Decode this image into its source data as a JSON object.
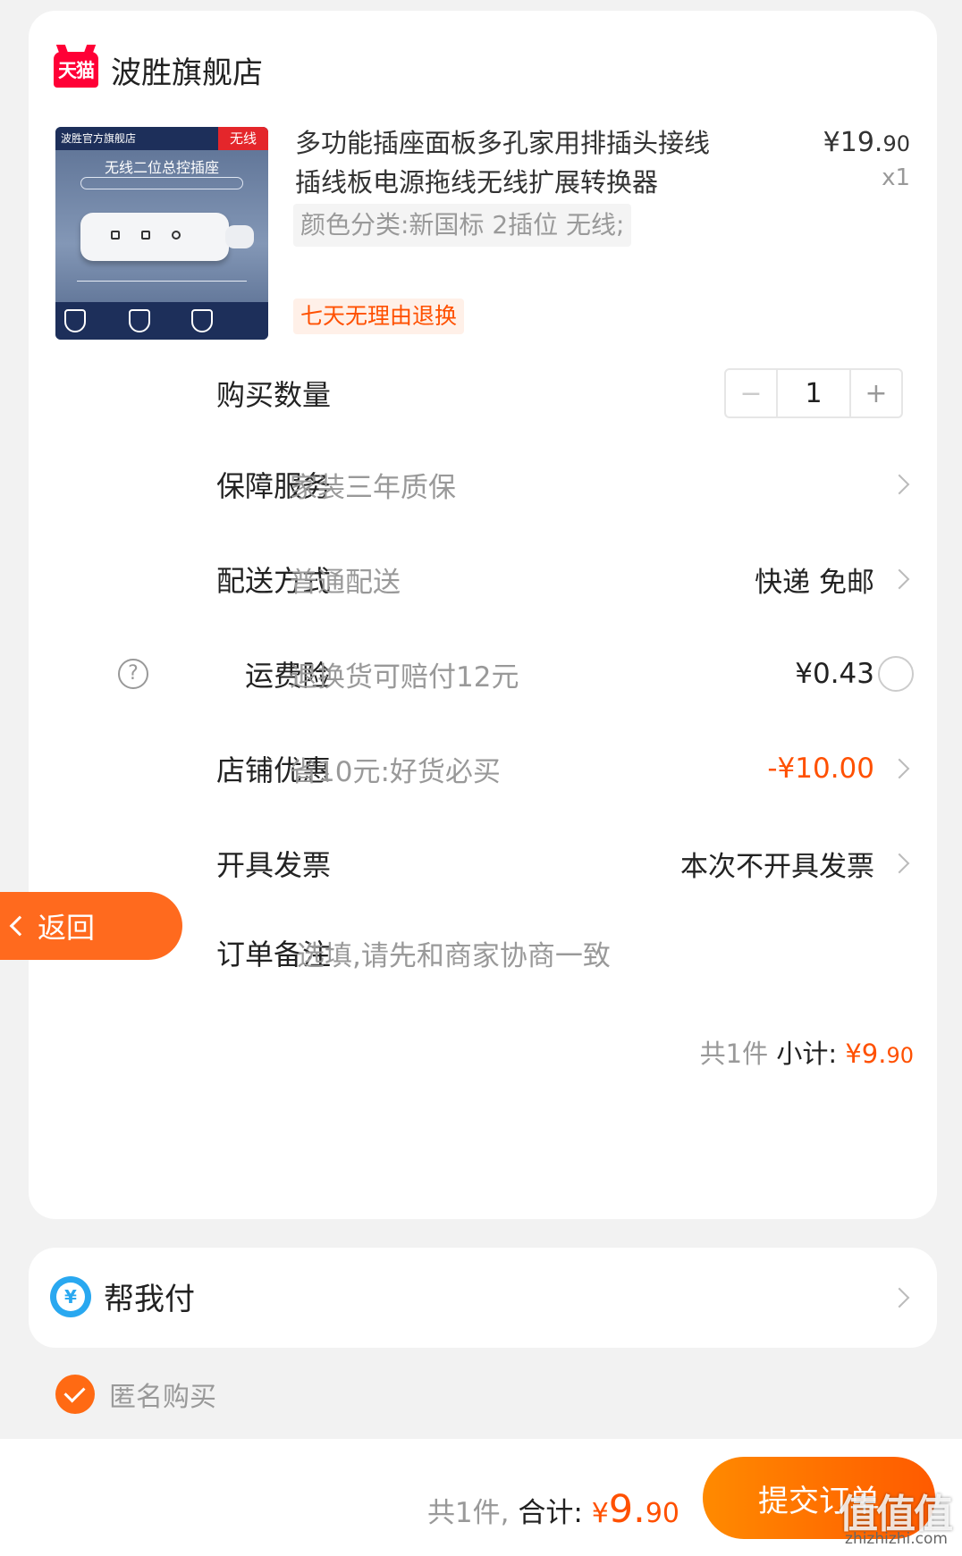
{
  "store": {
    "logo_text": "天猫",
    "name": "波胜旗舰店"
  },
  "product": {
    "thumbnail": {
      "brand": "波胜官方旗舰店",
      "tag": "无线",
      "title": "无线二位总控插座"
    },
    "title": "多功能插座面板多孔家用排插头接线插线板电源拖线无线扩展转换器",
    "price_prefix": "¥19.",
    "price_cents": "90",
    "quantity": "x1",
    "sku": "颜色分类:新国标 2插位 无线;",
    "return_tag": "七天无理由退换"
  },
  "rows": {
    "quantity": {
      "label": "购买数量",
      "minus": "−",
      "value": "1",
      "plus": "+"
    },
    "service": {
      "label": "保障服务",
      "value": "家装三年质保"
    },
    "delivery": {
      "label": "配送方式",
      "value": "普通配送",
      "right": "快递 免邮"
    },
    "shipping_insurance": {
      "label": "运费险",
      "value": "退换货可赔付12元",
      "right": "¥0.43",
      "help": "?"
    },
    "store_discount": {
      "label": "店铺优惠",
      "value": "省10元:好货必买",
      "right": "-¥10.00"
    },
    "invoice": {
      "label": "开具发票",
      "right": "本次不开具发票"
    },
    "note": {
      "label": "订单备注",
      "placeholder": "选填,请先和商家协商一致"
    }
  },
  "subtotal": {
    "count": "共1件",
    "label": "小计:",
    "price_prefix": "¥9.",
    "price_cents": "90"
  },
  "pay_for_me": {
    "icon": "¥",
    "label": "帮我付"
  },
  "anonymous": {
    "label": "匿名购买",
    "checked": true
  },
  "footer": {
    "count": "共1件,",
    "label": "合计:",
    "currency": "¥",
    "price_int": "9.",
    "price_cents": "90",
    "submit": "提交订单"
  },
  "back_button": {
    "label": "返回"
  },
  "watermark": {
    "text": "值值值",
    "url": "zhizhizhi.com"
  },
  "colors": {
    "accent": "#ff5000",
    "tmall_red": "#ff0036",
    "pay_blue": "#29a8f0"
  }
}
